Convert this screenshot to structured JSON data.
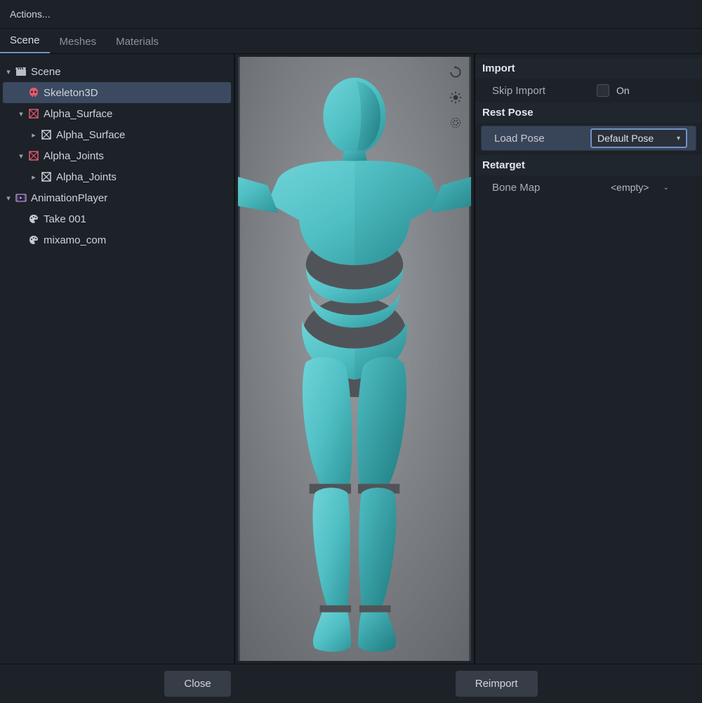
{
  "topbar": {
    "actions_label": "Actions..."
  },
  "tabs": [
    {
      "label": "Scene",
      "active": true
    },
    {
      "label": "Meshes",
      "active": false
    },
    {
      "label": "Materials",
      "active": false
    }
  ],
  "tree": {
    "scene": "Scene",
    "skeleton3d": "Skeleton3D",
    "alpha_surface": "Alpha_Surface",
    "alpha_surface_child": "Alpha_Surface",
    "alpha_joints": "Alpha_Joints",
    "alpha_joints_child": "Alpha_Joints",
    "animation_player": "AnimationPlayer",
    "take001": "Take 001",
    "mixamo": "mixamo_com"
  },
  "right": {
    "import_header": "Import",
    "skip_import": "Skip Import",
    "on_label": "On",
    "rest_pose_header": "Rest Pose",
    "load_pose_label": "Load Pose",
    "load_pose_value": "Default Pose",
    "retarget_header": "Retarget",
    "bone_map_label": "Bone Map",
    "bone_map_value": "<empty>"
  },
  "footer": {
    "close_label": "Close",
    "reimport_label": "Reimport"
  },
  "viewport_icons": [
    "rotate",
    "sun",
    "gear"
  ],
  "colors": {
    "accent": "#6f93c7",
    "panel": "#1d2229",
    "viewport": "#8c8f92",
    "mannequin": "#4fbfc4",
    "mannequin_dark": "#2f9ea3"
  }
}
